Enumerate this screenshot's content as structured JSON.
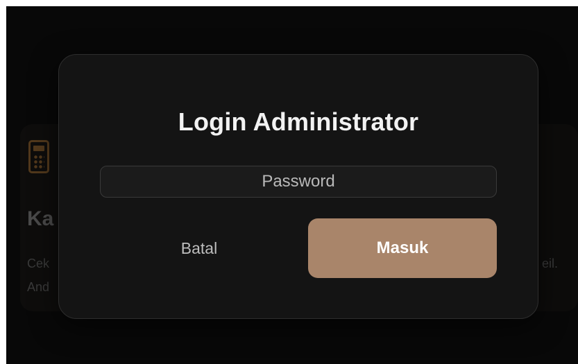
{
  "background": {
    "card_title": "Ka",
    "card_description_line1": "Cek",
    "card_description_line2": "And",
    "card_description_trail": "eil.",
    "card_icon": "calculator-icon"
  },
  "modal": {
    "title": "Login Administrator",
    "password_placeholder": "Password",
    "password_value": "",
    "cancel_label": "Batal",
    "submit_label": "Masuk"
  },
  "colors": {
    "accent": "#a9856a",
    "modal_background": "#141414",
    "page_background": "#080808"
  }
}
